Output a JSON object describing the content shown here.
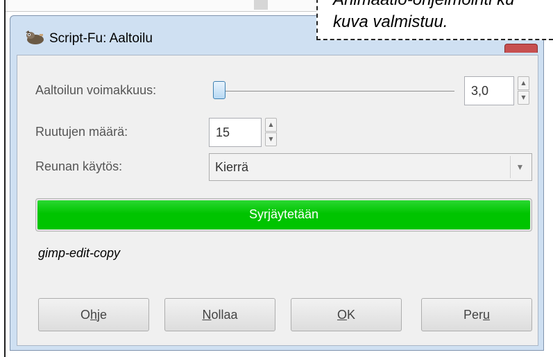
{
  "window": {
    "title": "Script-Fu: Aaltoilu",
    "icon": "gimp-wilber-icon"
  },
  "fields": {
    "intensity_label": "Aaltoilun voimakkuus:",
    "intensity_value": "3,0",
    "tiles_label": "Ruutujen määrä:",
    "tiles_value": "15",
    "edge_label": "Reunan käytös:",
    "edge_value": "Kierrä"
  },
  "progress": {
    "text": "Syrjäytetään",
    "fraction": 1.0,
    "color": "#00c400"
  },
  "status_text": "gimp-edit-copy",
  "buttons": {
    "help": {
      "before": "O",
      "mnemonic": "h",
      "after": "je"
    },
    "reset": {
      "before": "",
      "mnemonic": "N",
      "after": "ollaa"
    },
    "ok": {
      "before": "",
      "mnemonic": "O",
      "after": "K"
    },
    "cancel": {
      "before": "Per",
      "mnemonic": "u",
      "after": ""
    }
  },
  "callout": {
    "line1": "Animaatio-ohjelmointi ku",
    "line2": "kuva valmistuu."
  }
}
